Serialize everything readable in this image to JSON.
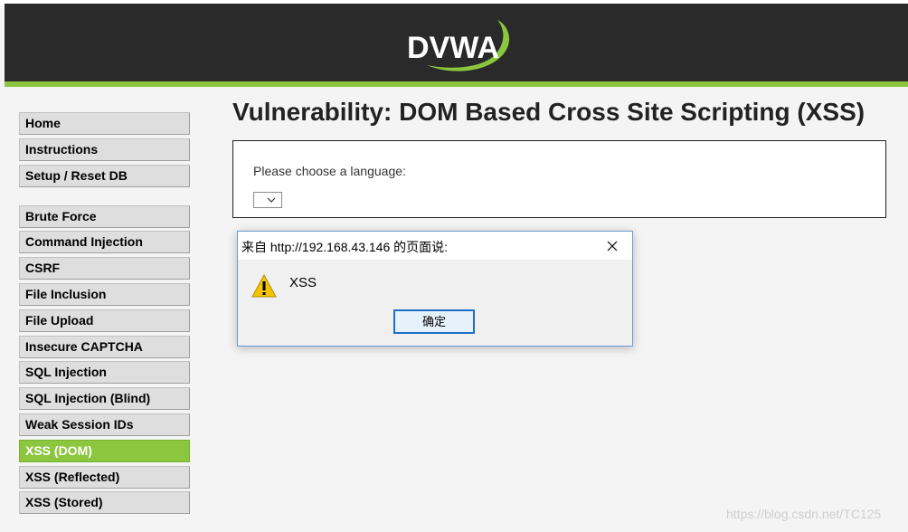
{
  "header": {
    "logo_text": "DVWA",
    "accent": "#8cc63e"
  },
  "menu": {
    "group1": [
      {
        "label": "Home"
      },
      {
        "label": "Instructions"
      },
      {
        "label": "Setup / Reset DB"
      }
    ],
    "group2": [
      {
        "label": "Brute Force"
      },
      {
        "label": "Command Injection"
      },
      {
        "label": "CSRF"
      },
      {
        "label": "File Inclusion"
      },
      {
        "label": "File Upload"
      },
      {
        "label": "Insecure CAPTCHA"
      },
      {
        "label": "SQL Injection"
      },
      {
        "label": "SQL Injection (Blind)"
      },
      {
        "label": "Weak Session IDs"
      },
      {
        "label": "XSS (DOM)",
        "active": true
      },
      {
        "label": "XSS (Reflected)"
      },
      {
        "label": "XSS (Stored)"
      }
    ]
  },
  "main": {
    "title": "Vulnerability: DOM Based Cross Site Scripting (XSS)",
    "prompt_label": "Please choose a language:",
    "select_value": ""
  },
  "dialog": {
    "title": "来自 http://192.168.43.146 的页面说:",
    "message": "XSS",
    "ok_label": "确定",
    "icon": "warning-icon"
  },
  "watermark": "https://blog.csdn.net/TC125"
}
